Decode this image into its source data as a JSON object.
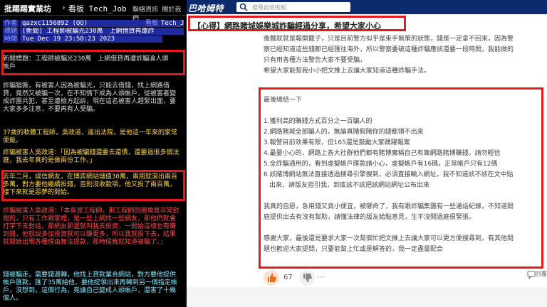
{
  "ptt": {
    "brand": "批踢踢實業坊",
    "separator": "›",
    "board_label": "看板 Tech_Job",
    "top_links": "聯絡資訊  關於我們",
    "meta": {
      "author_key": "作者",
      "author": "qazxc1156892 (QQ)",
      "board_key": "看板",
      "board": "Tech_Job",
      "title_key": "標題",
      "title": "[新聞] 工程師被騙光230萬　上網借貸再遭詐",
      "time_key": "時間",
      "time": "Tue Dec 19 23:58:23 2023"
    },
    "news_title": "新聞標題：工程師被騙光230萬　上網借貸再遭詐騙淪人頭帳戶",
    "para1": "詐騙猖獗，有被害人因為被騙光，只能去借錢，找上網路借貸，竟然又被騙一次，在不知情下成為人頭帳戶，從被害者變成詐團共犯，甚至遭檢方起訴，現在這名被害人趕緊出面，要大家多多注意，不要再有人受騙。",
    "para2": "37歲的軟體工程師，吳政道，進出法院，是他這一年來的家常便飯。",
    "para3": "詐騙被害人吳政道：「因為被騙錢還要去還債，還要過很多個法庭，我去年真的是做兩份工作。」",
    "para4": "去年二月，誤信網友，在博弈網站儲值30萬，兩周就滾出兩百多萬，對方要他繼續投錢，否則沒收款項，他又投了兩百萬，接下來就是惡夢的開始。",
    "para5": "詐騙被害人吳政道：「本身是工程師，那工程師的環境是非常封閉的，只有工作跟家裡，是一些上網找一些網友，那他們就會打字下去對話，那網友那邊就叫我去投資，一開始這樣也有賺到錢，他就說多加投資就可以賺更多，所以我就投下去，結果就開始出現各種理由無法提款，那時候我就知道被騙了。」",
    "para6": "錢被騙走，需要錢週轉，他找上貸款業合網站，對方要他提供帳戶匯款，匯了35萬給他，要他提領出來再轉到另一個指定帳戶，沒想到，這個行為，竟讓自己變成人頭帳戶，還害了十幾個人。"
  },
  "forum": {
    "logo": "巴哈姆特",
    "search_placeholder": "搜尋此哈啦板",
    "post_title": "【心得】網路賭城娛樂城詐騙經過分享，希望大家小心",
    "intro_lines": [
      "後麵就就是報開籠子，只是目前警方似乎是束手無策的狀態，錢是一定拿不回來，因為警",
      "察已經知道這些錢都已經匯往海外，所以警察要破這種詐騙應該還要一段時間，我能做的",
      "只有用各種方法警告大家不要受騙，",
      "希望大家能幫我小小把文推上去讓大家知道這種詐騙手法。"
    ],
    "summary_heading": "最後總結一下",
    "summary_items": [
      "1.獲利高的賺錢方式百分之一百騙人的",
      "2.網路賭城全部騙人的，無論真賭假賭你的錢都領不出來",
      "3.報警目前效果有限，但165還是鼓勵大家踴躍報案",
      "4.最要小心的，網路上各大社群他們都有賭博魔稱自己有靠網路賭博賺錢，請勿輕信",
      "5.全詐騙通用的，看到虛擬帳戶匯款請小心，虛擬帳戶有16碼，正常帳戶只有12碼",
      "6.該賭博網站無法直接透過搜尋引擎搜到，必須直接輸入網址，我不知道該不該在文中貼"
    ],
    "summary_item6_cont": "出來，請版友指引我，到底該不該把該網站網址公布出來",
    "closing_lines": [
      "我真的自愿，急用錢又貪小便宜，被哪肏了，我有跟詐騙集團有一些通話紀錄，不知道開",
      "庭提供出去有沒有幫助，請懂法律的版友給點意見，生平沒開過庭很緊張。"
    ],
    "thanks_lines": [
      "感謝大家，最後還是要求大家一次幫個忙把文推上去讓大家可以更方便搜尋到，有其他問",
      "題也歡迎大家提問，只要能幫上忙或是解答的，我一定盡量配合"
    ],
    "like_count": "67",
    "reply_label": "回覆"
  },
  "colors": {
    "highlight_border": "#e8191c",
    "forum_header": "#0b2b6e",
    "ptt_background": "#000000",
    "ptt_yellow": "#ffd84a",
    "ptt_red": "#ff4747",
    "ptt_cyan": "#7ee8ff"
  }
}
